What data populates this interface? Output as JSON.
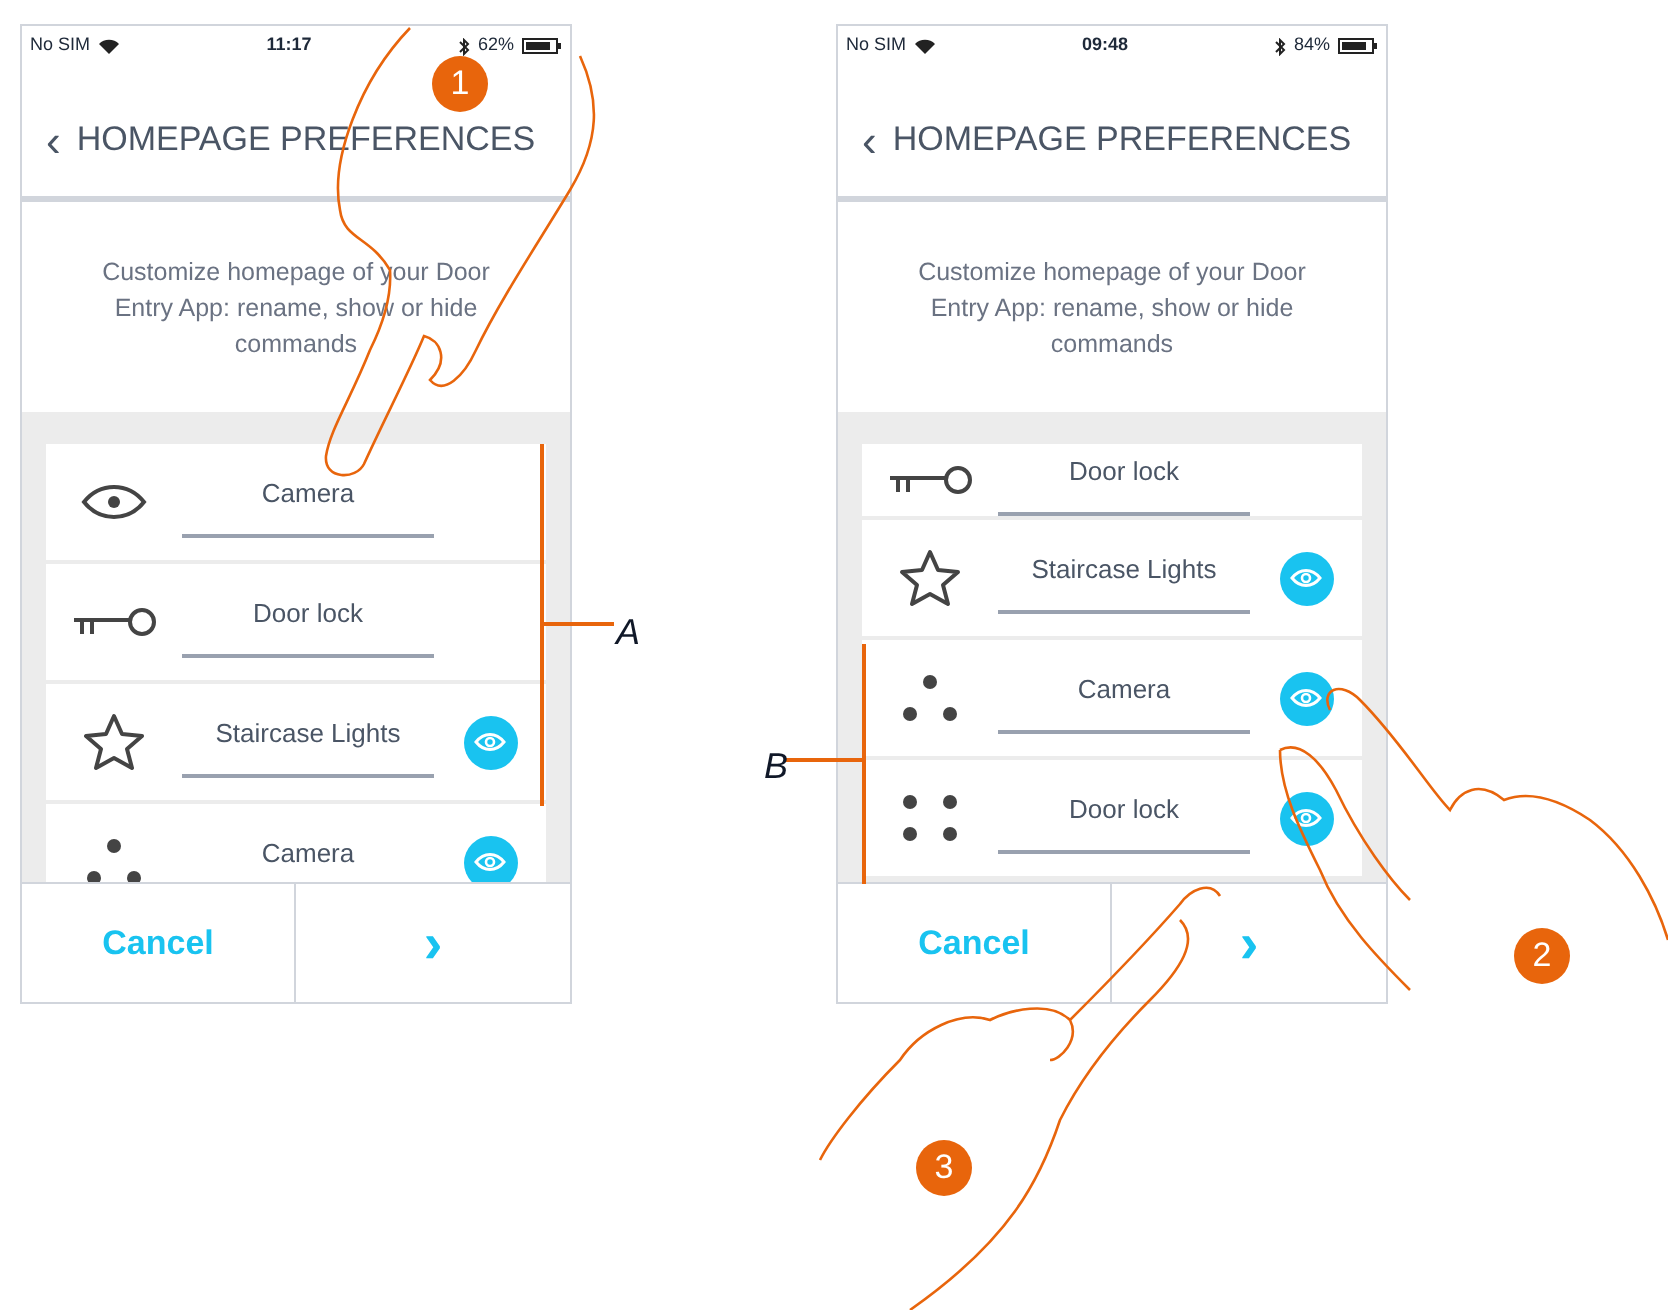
{
  "screens": [
    {
      "status": {
        "carrier": "No SIM",
        "time": "11:17",
        "battery": "62%"
      },
      "back": "‹",
      "title": "HOMEPAGE PREFERENCES",
      "description": "Customize homepage of your Door Entry App: rename, show or hide commands",
      "scrolled": false,
      "items": [
        {
          "kind": "eye",
          "label": "Camera",
          "shown": false
        },
        {
          "kind": "key",
          "label": "Door lock",
          "shown": false
        },
        {
          "kind": "star",
          "label": "Staircase Lights",
          "shown": true
        },
        {
          "kind": "dots3",
          "label": "Camera",
          "shown": true
        }
      ],
      "buttons": {
        "cancel": "Cancel",
        "next": "›"
      }
    },
    {
      "status": {
        "carrier": "No SIM",
        "time": "09:48",
        "battery": "84%"
      },
      "back": "‹",
      "title": "HOMEPAGE PREFERENCES",
      "description": "Customize homepage of your Door Entry App: rename, show or hide commands",
      "scrolled": true,
      "items": [
        {
          "kind": "key",
          "label": "Door lock",
          "shown": false
        },
        {
          "kind": "star",
          "label": "Staircase Lights",
          "shown": true
        },
        {
          "kind": "dots3",
          "label": "Camera",
          "shown": true
        },
        {
          "kind": "dots4",
          "label": "Door lock",
          "shown": true
        }
      ],
      "buttons": {
        "cancel": "Cancel",
        "next": "›"
      }
    }
  ],
  "callouts": [
    {
      "label": "A"
    },
    {
      "label": "B"
    }
  ],
  "steps": [
    "1",
    "2",
    "3"
  ]
}
